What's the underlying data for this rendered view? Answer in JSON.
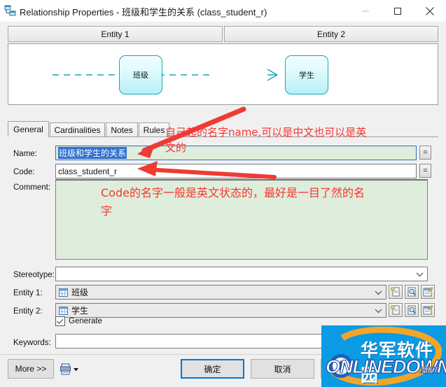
{
  "window": {
    "title": "Relationship Properties - 班级和学生的关系 (class_student_r)",
    "icon": "relationship-icon",
    "minimize": "–",
    "maximize": "□",
    "close": "✕"
  },
  "entity_panel": {
    "header1": "Entity 1",
    "header2": "Entity 2",
    "entity1_name": "班级",
    "entity2_name": "学生",
    "link_style": "dashed",
    "cardinality_marker": "crow-foot"
  },
  "tabs": [
    {
      "label": "General",
      "active": true
    },
    {
      "label": "Cardinalities",
      "active": false
    },
    {
      "label": "Notes",
      "active": false
    },
    {
      "label": "Rules",
      "active": false
    }
  ],
  "form": {
    "name_label": "Name:",
    "name_value": "班级和学生的关系",
    "name_selected": true,
    "code_label": "Code:",
    "code_value": "class_student_r",
    "comment_label": "Comment:",
    "comment_value": "",
    "stereotype_label": "Stereotype:",
    "stereotype_value": "",
    "entity1_label": "Entity 1:",
    "entity1_value": "班级",
    "entity2_label": "Entity 2:",
    "entity2_value": "学生",
    "generate_label": "Generate",
    "generate_checked": true,
    "keywords_label": "Keywords:",
    "keywords_value": "",
    "eq_button_label": "="
  },
  "footer": {
    "more_label": "More >>",
    "ok_label": "确定",
    "cancel_label": "取消",
    "help_label": ""
  },
  "annotations": {
    "name_note_line1": "自己起的名字name,可以是中文也可以是英",
    "name_note_line2": "文的",
    "comment_note_line1": "Code的名字一般是英文状态的，最好是一目了然的名",
    "comment_note_line2": "字",
    "color": "#f5362f"
  },
  "watermark": {
    "cn_text": "华军软件园",
    "en_text": "ONLINEDOWN",
    "suffix": ".NET",
    "bg_color": "#0b9ae4"
  }
}
